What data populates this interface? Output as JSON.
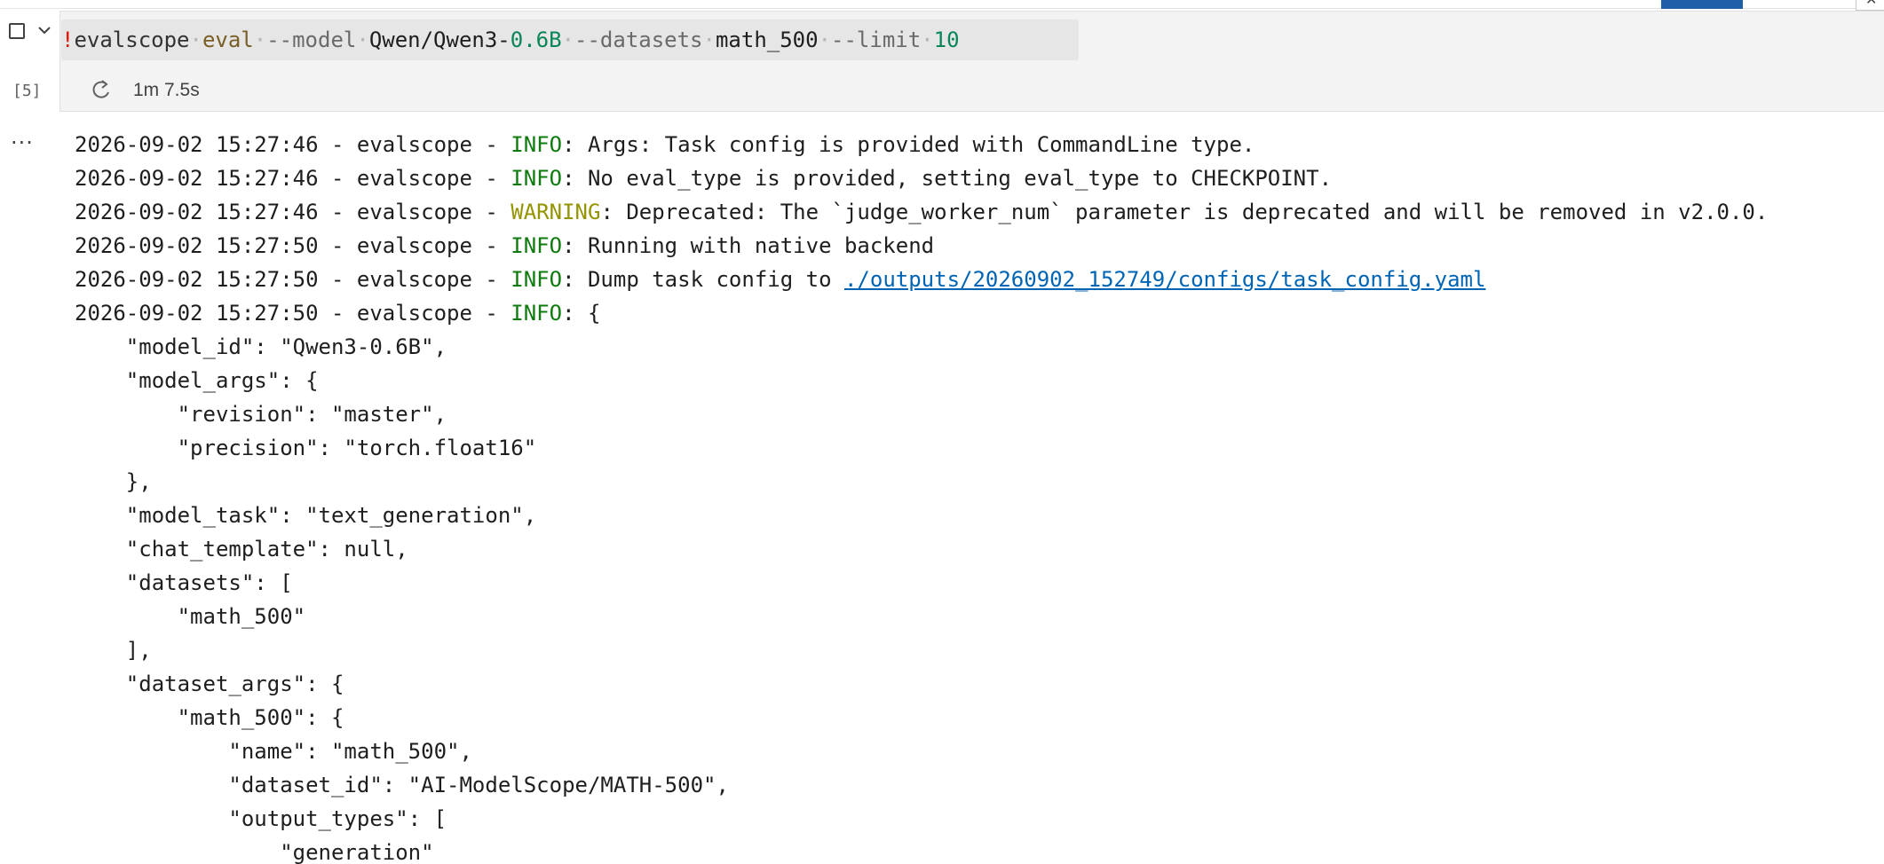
{
  "cell": {
    "execution_count": "[5]",
    "duration": "1m 7.5s",
    "command": {
      "bang": "!",
      "cmd": "evalscope",
      "sub": "eval",
      "flag_model": "--model",
      "model_prefix": "Qwen/Qwen3-",
      "model_version": "0.6B",
      "flag_datasets": "--datasets",
      "dataset": "math_500",
      "flag_limit": "--limit",
      "limit": "10"
    }
  },
  "output": {
    "ellipsis": "...",
    "log_lines": [
      {
        "prefix": "2026-09-02 15:27:46 - evalscope - ",
        "level": "INFO",
        "message": ": Args: Task config is provided with CommandLine type."
      },
      {
        "prefix": "2026-09-02 15:27:46 - evalscope - ",
        "level": "INFO",
        "message": ": No eval_type is provided, setting eval_type to CHECKPOINT."
      },
      {
        "prefix": "2026-09-02 15:27:46 - evalscope - ",
        "level": "WARNING",
        "message": ": Deprecated: The `judge_worker_num` parameter is deprecated and will be removed in v2.0.0."
      },
      {
        "prefix": "2026-09-02 15:27:50 - evalscope - ",
        "level": "INFO",
        "message": ": Running with native backend"
      },
      {
        "prefix": "2026-09-02 15:27:50 - evalscope - ",
        "level": "INFO",
        "message": ": Dump task config to ",
        "link": "./outputs/20260902_152749/configs/task_config.yaml"
      },
      {
        "prefix": "2026-09-02 15:27:50 - evalscope - ",
        "level": "INFO",
        "message": ": {"
      }
    ],
    "json_lines": [
      "    \"model_id\": \"Qwen3-0.6B\",",
      "    \"model_args\": {",
      "        \"revision\": \"master\",",
      "        \"precision\": \"torch.float16\"",
      "    },",
      "    \"model_task\": \"text_generation\",",
      "    \"chat_template\": null,",
      "    \"datasets\": [",
      "        \"math_500\"",
      "    ],",
      "    \"dataset_args\": {",
      "        \"math_500\": {",
      "            \"name\": \"math_500\",",
      "            \"dataset_id\": \"AI-ModelScope/MATH-500\",",
      "            \"output_types\": [",
      "                \"generation\""
    ]
  },
  "icons": {
    "cell_toggle": "checkbox-icon",
    "collapse": "chevron-down-icon",
    "status": "refresh-icon",
    "corner": "close-icon"
  },
  "colors": {
    "info": "#0f7b0f",
    "warning": "#949400",
    "link": "#0064b4",
    "cell_bg": "#f3f3f3"
  }
}
